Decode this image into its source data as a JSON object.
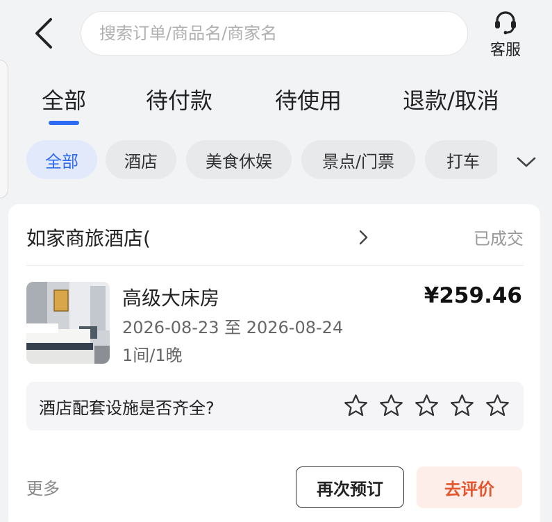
{
  "header": {
    "back_icon": "chevron-left-icon",
    "search_placeholder": "搜索订单/商品名/商家名",
    "customer_service_icon": "headset-icon",
    "customer_service_label": "客服"
  },
  "status_tabs": [
    {
      "label": "全部",
      "active": true
    },
    {
      "label": "待付款",
      "active": false
    },
    {
      "label": "待使用",
      "active": false
    },
    {
      "label": "退款/取消",
      "active": false
    }
  ],
  "category_chips": [
    {
      "label": "全部",
      "active": true
    },
    {
      "label": "酒店",
      "active": false
    },
    {
      "label": "美食休娱",
      "active": false
    },
    {
      "label": "景点/门票",
      "active": false
    },
    {
      "label": "打车",
      "active": false
    }
  ],
  "category_expand_icon": "chevron-down-icon",
  "order": {
    "shop_name": "如家商旅酒店(",
    "status": "已成交",
    "room_name": "高级大床房",
    "price": "¥259.46",
    "date_range": "2026-08-23 至 2026-08-24",
    "quantity": "1间/1晚",
    "rating_question": "酒店配套设施是否齐全?",
    "rating_stars_total": 5,
    "rating_value": 0,
    "more_label": "更多",
    "rebook_label": "再次预订",
    "review_label": "去评价"
  },
  "colors": {
    "accent": "#2f6bf2",
    "review_text": "#e4572e",
    "review_bg": "#fdeee9",
    "page_bg": "#f2f3f5"
  }
}
